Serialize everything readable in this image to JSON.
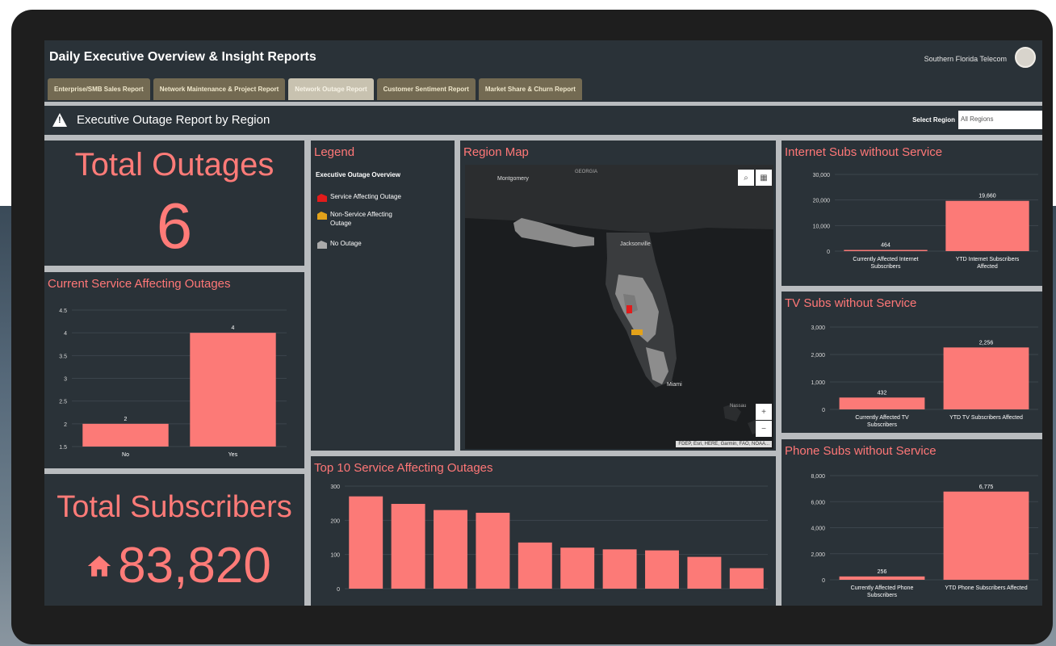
{
  "header": {
    "title": "Daily Executive Overview & Insight Reports",
    "company": "Southern Florida Telecom"
  },
  "tabs": [
    {
      "label": "Enterprise/SMB Sales Report",
      "active": false
    },
    {
      "label": "Network Maintenance & Project Report",
      "active": false
    },
    {
      "label": "Network Outage Report",
      "active": true
    },
    {
      "label": "Customer Sentiment Report",
      "active": false
    },
    {
      "label": "Market Share & Churn Report",
      "active": false
    }
  ],
  "subheader": {
    "title": "Executive Outage Report by Region",
    "select_label": "Select Region",
    "select_value": "All Regions"
  },
  "kpis": {
    "total_outages_label": "Total Outages",
    "total_outages_value": "6",
    "total_subscribers_label": "Total Subscribers",
    "total_subscribers_value": "83,820"
  },
  "legend": {
    "title": "Legend",
    "heading": "Executive Outage Overview",
    "items": [
      {
        "label": "Service Affecting Outage",
        "color": "#e21b1b"
      },
      {
        "label": "Non-Service Affecting Outage",
        "color": "#e3a21a"
      },
      {
        "label": "No Outage",
        "color": "#aaaaaa"
      }
    ]
  },
  "map": {
    "title": "Region Map",
    "labels": [
      "GEORGIA",
      "Montgomery",
      "Jacksonville",
      "Miami",
      "Nassau"
    ],
    "attribution": "FDEP, Esri, HERE, Garmin, FAO, NOAA..."
  },
  "colors": {
    "bar": "#fc7a77",
    "panel": "#2a3238",
    "title": "#ff7777"
  },
  "chart_data": [
    {
      "id": "current_service",
      "type": "bar",
      "title": "Current Service Affecting Outages",
      "categories": [
        "No",
        "Yes"
      ],
      "values": [
        2,
        4
      ],
      "value_labels": [
        "2",
        "4"
      ],
      "ylim": [
        1.5,
        4.5
      ],
      "yticks": [
        1.5,
        2,
        2.5,
        3,
        3.5,
        4,
        4.5
      ],
      "ytick_labels": [
        "1.5",
        "2",
        "2.5",
        "3",
        "3.5",
        "4",
        "4.5"
      ]
    },
    {
      "id": "top10",
      "type": "bar",
      "title": "Top 10 Service Affecting Outages",
      "categories": [
        "",
        "",
        "",
        "",
        "",
        "",
        "",
        "",
        "",
        ""
      ],
      "values": [
        270,
        248,
        230,
        222,
        135,
        120,
        115,
        112,
        93,
        60
      ],
      "ylim": [
        0,
        300
      ],
      "yticks": [
        0,
        100,
        200,
        300
      ],
      "ytick_labels": [
        "0",
        "100",
        "200",
        "300"
      ]
    },
    {
      "id": "internet",
      "type": "bar",
      "title": "Internet Subs without Service",
      "categories": [
        "Currently Affected Internet Subscribers",
        "YTD Internet Subscribers Affected"
      ],
      "values": [
        464,
        19660
      ],
      "value_labels": [
        "464",
        "19,660"
      ],
      "ylim": [
        0,
        30000
      ],
      "yticks": [
        0,
        10000,
        20000,
        30000
      ],
      "ytick_labels": [
        "0",
        "10,000",
        "20,000",
        "30,000"
      ]
    },
    {
      "id": "tv",
      "type": "bar",
      "title": "TV Subs without Service",
      "categories": [
        "Currently Affected TV Subscribers",
        "YTD TV Subscribers Affected"
      ],
      "values": [
        432,
        2256
      ],
      "value_labels": [
        "432",
        "2,256"
      ],
      "ylim": [
        0,
        3000
      ],
      "yticks": [
        0,
        1000,
        2000,
        3000
      ],
      "ytick_labels": [
        "0",
        "1,000",
        "2,000",
        "3,000"
      ]
    },
    {
      "id": "phone",
      "type": "bar",
      "title": "Phone Subs without Service",
      "categories": [
        "Currently Affected Phone Subscribers",
        "YTD Phone Subscribers Affected"
      ],
      "values": [
        256,
        6775
      ],
      "value_labels": [
        "256",
        "6,775"
      ],
      "ylim": [
        0,
        8000
      ],
      "yticks": [
        0,
        2000,
        4000,
        6000,
        8000
      ],
      "ytick_labels": [
        "0",
        "2,000",
        "4,000",
        "6,000",
        "8,000"
      ]
    }
  ]
}
